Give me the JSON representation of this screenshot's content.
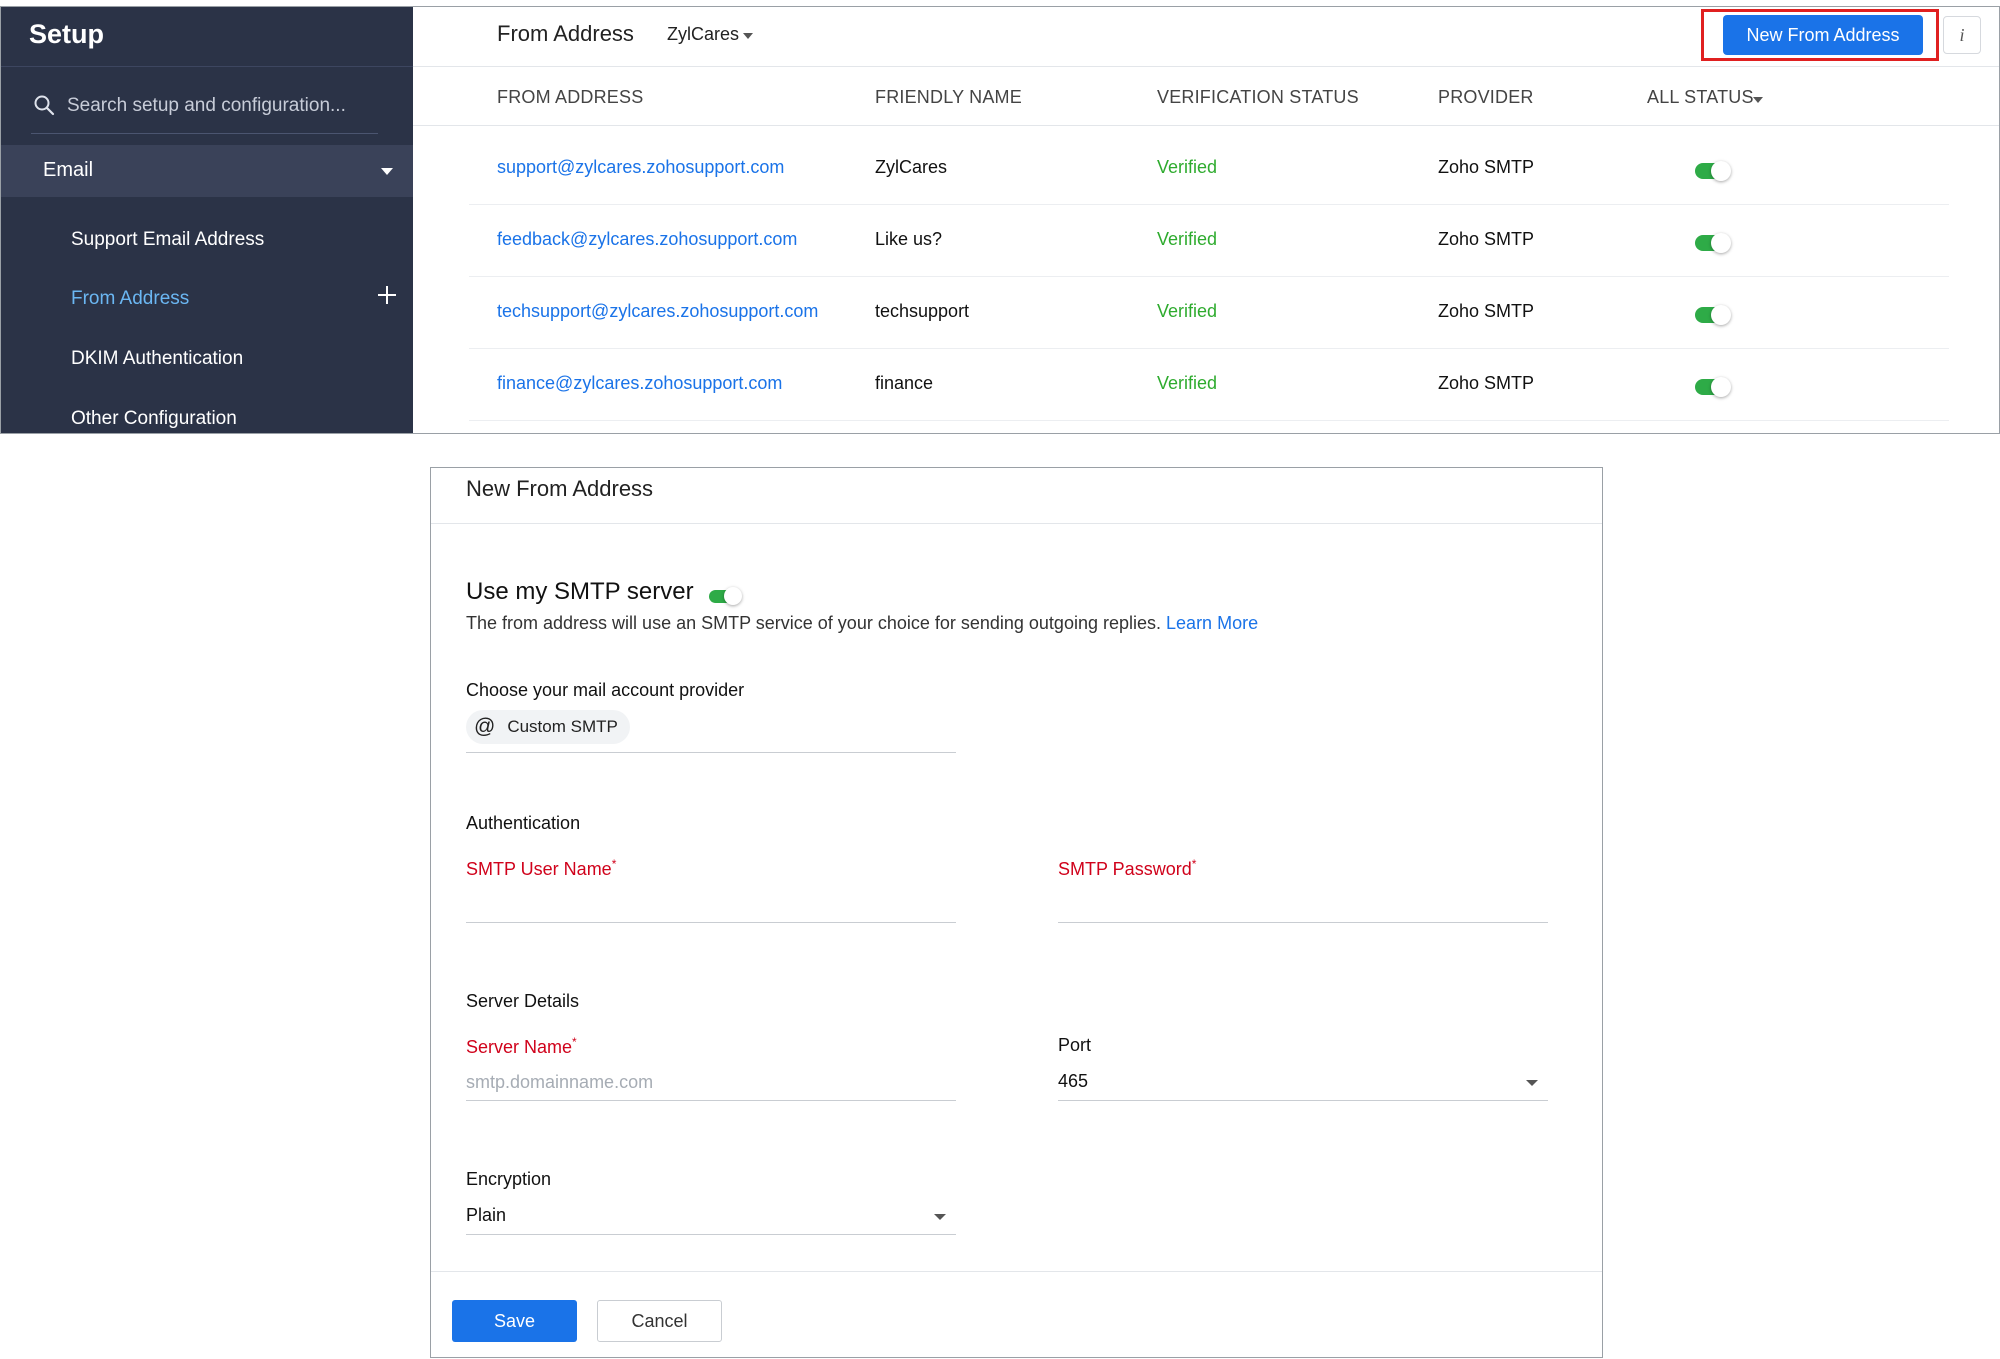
{
  "sidebar": {
    "title": "Setup",
    "search_placeholder": "Search setup and configuration...",
    "section_label": "Email",
    "items": [
      {
        "label": "Support Email Address"
      },
      {
        "label": "From Address"
      },
      {
        "label": "DKIM Authentication"
      },
      {
        "label": "Other Configuration"
      }
    ],
    "active_color": "#6bb7f3",
    "background": "#2b3347"
  },
  "header": {
    "title": "From Address",
    "department": "ZylCares",
    "new_button_label": "New From Address",
    "info_label": "i"
  },
  "table": {
    "columns": [
      "FROM ADDRESS",
      "FRIENDLY NAME",
      "VERIFICATION STATUS",
      "PROVIDER",
      "ALL STATUS"
    ],
    "rows": [
      {
        "address": "support@zylcares.zohosupport.com",
        "name": "ZylCares",
        "status": "Verified",
        "provider": "Zoho SMTP",
        "enabled": true
      },
      {
        "address": "feedback@zylcares.zohosupport.com",
        "name": "Like us?",
        "status": "Verified",
        "provider": "Zoho SMTP",
        "enabled": true
      },
      {
        "address": "techsupport@zylcares.zohosupport.com",
        "name": "techsupport",
        "status": "Verified",
        "provider": "Zoho SMTP",
        "enabled": true
      },
      {
        "address": "finance@zylcares.zohosupport.com",
        "name": "finance",
        "status": "Verified",
        "provider": "Zoho SMTP",
        "enabled": true
      }
    ],
    "link_color": "#1a73e8",
    "verified_color": "#2eab2e"
  },
  "form": {
    "title": "New From Address",
    "smtp_heading": "Use my SMTP server",
    "smtp_enabled": true,
    "smtp_desc": "The from address will use an SMTP service of your choice for sending outgoing replies.",
    "learn_more": "Learn More",
    "provider_label": "Choose your mail account provider",
    "provider_value": "Custom SMTP",
    "auth_section": "Authentication",
    "smtp_user_label": "SMTP User Name",
    "smtp_user_value": "",
    "smtp_password_label": "SMTP Password",
    "smtp_password_value": "",
    "server_section": "Server Details",
    "server_name_label": "Server Name",
    "server_name_placeholder": "smtp.domainname.com",
    "port_label": "Port",
    "port_value": "465",
    "encryption_label": "Encryption",
    "encryption_value": "Plain",
    "required_mark": "*",
    "save_label": "Save",
    "cancel_label": "Cancel",
    "required_color": "#d0021b",
    "primary_color": "#1a73e8"
  }
}
